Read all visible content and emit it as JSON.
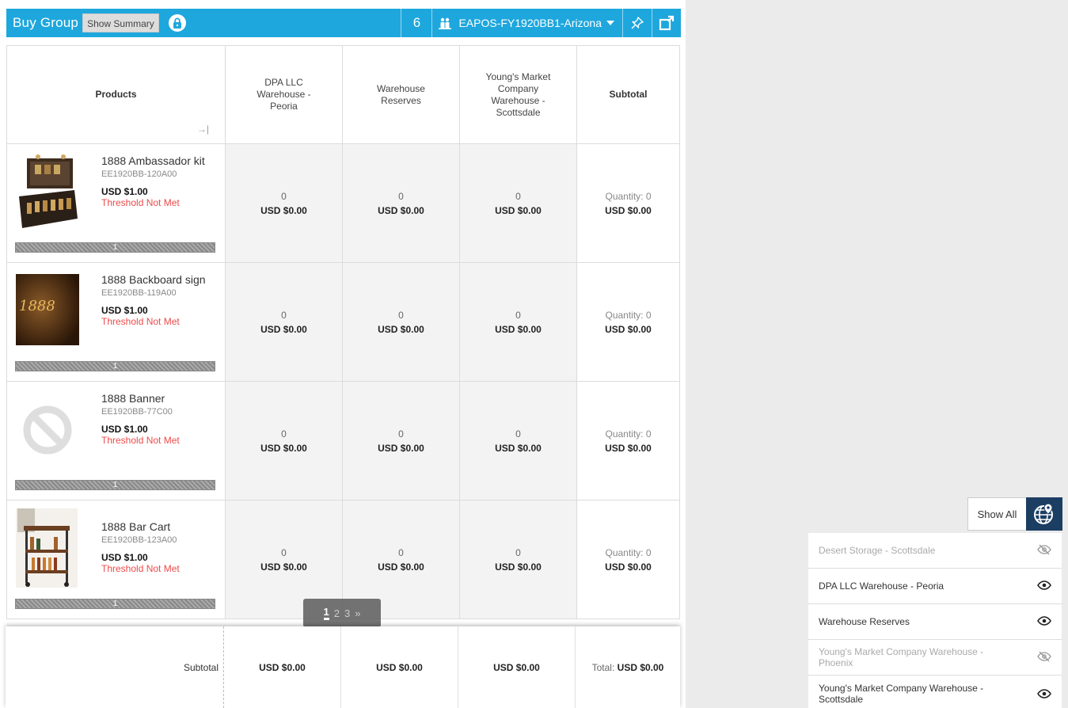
{
  "header": {
    "title": "Buy Group",
    "summary_label": "Show Summary",
    "count": "6",
    "program": "EAPOS-FY1920BB1-Arizona"
  },
  "table": {
    "columns": [
      "Products",
      "DPA LLC Warehouse - Peoria",
      "Warehouse Reserves",
      "Young's Market Company Warehouse - Scottsdale",
      "Subtotal"
    ],
    "rows": [
      {
        "name": "1888 Ambassador kit",
        "sku": "EE1920BB-120A00",
        "price": "USD $1.00",
        "threshold": "Threshold Not Met",
        "bar": "1",
        "cells": [
          {
            "qty": "0",
            "amount": "USD $0.00"
          },
          {
            "qty": "0",
            "amount": "USD $0.00"
          },
          {
            "qty": "0",
            "amount": "USD $0.00"
          }
        ],
        "subtotal_qty": "Quantity: 0",
        "subtotal_amount": "USD $0.00"
      },
      {
        "name": "1888 Backboard sign",
        "sku": "EE1920BB-119A00",
        "price": "USD $1.00",
        "threshold": "Threshold Not Met",
        "bar": "1",
        "image_text": "1888",
        "cells": [
          {
            "qty": "0",
            "amount": "USD $0.00"
          },
          {
            "qty": "0",
            "amount": "USD $0.00"
          },
          {
            "qty": "0",
            "amount": "USD $0.00"
          }
        ],
        "subtotal_qty": "Quantity: 0",
        "subtotal_amount": "USD $0.00"
      },
      {
        "name": "1888 Banner",
        "sku": "EE1920BB-77C00",
        "price": "USD $1.00",
        "threshold": "Threshold Not Met",
        "bar": "1",
        "cells": [
          {
            "qty": "0",
            "amount": "USD $0.00"
          },
          {
            "qty": "0",
            "amount": "USD $0.00"
          },
          {
            "qty": "0",
            "amount": "USD $0.00"
          }
        ],
        "subtotal_qty": "Quantity: 0",
        "subtotal_amount": "USD $0.00"
      },
      {
        "name": "1888 Bar Cart",
        "sku": "EE1920BB-123A00",
        "price": "USD $1.00",
        "threshold": "Threshold Not Met",
        "bar": "1",
        "cells": [
          {
            "qty": "0",
            "amount": "USD $0.00"
          },
          {
            "qty": "0",
            "amount": "USD $0.00"
          },
          {
            "qty": "0",
            "amount": "USD $0.00"
          }
        ],
        "subtotal_qty": "Quantity: 0",
        "subtotal_amount": "USD $0.00"
      }
    ]
  },
  "pager": {
    "pages": [
      "1",
      "2",
      "3"
    ],
    "current": "1",
    "next": "»"
  },
  "footer": {
    "label": "Subtotal",
    "values": [
      "USD $0.00",
      "USD $0.00",
      "USD $0.00"
    ],
    "total_label": "Total:",
    "total_value": "USD $0.00"
  },
  "locations": {
    "show_all_label": "Show All",
    "items": [
      {
        "name": "Desert Storage - Scottsdale",
        "visible": false
      },
      {
        "name": "DPA LLC Warehouse - Peoria",
        "visible": true
      },
      {
        "name": "Warehouse Reserves",
        "visible": true
      },
      {
        "name": "Young's Market Company Warehouse - Phoenix",
        "visible": false
      },
      {
        "name": "Young's Market Company Warehouse - Scottsdale",
        "visible": true
      }
    ]
  },
  "colors": {
    "header_bg": "#1ea7dd",
    "warning": "#ee4a4a",
    "globe_bg": "#1b3e62"
  }
}
